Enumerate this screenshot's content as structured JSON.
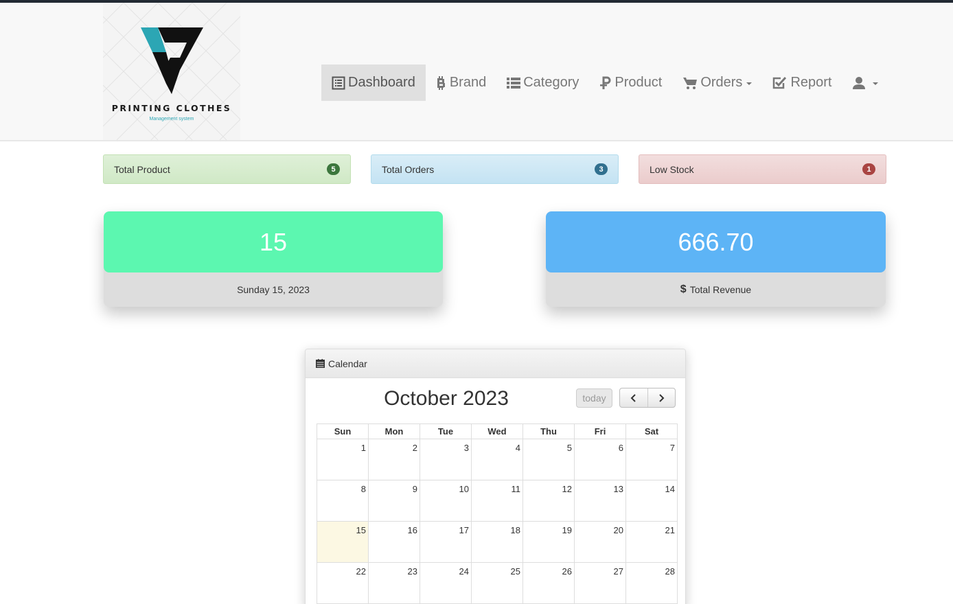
{
  "logo": {
    "title": "PRINTING CLOTHES",
    "subtitle": "Management system"
  },
  "nav": {
    "items": [
      {
        "label": "Dashboard",
        "icon": "list-alt-icon",
        "active": true
      },
      {
        "label": "Brand",
        "icon": "bitcoin-icon"
      },
      {
        "label": "Category",
        "icon": "list-icon"
      },
      {
        "label": "Product",
        "icon": "ruble-icon"
      },
      {
        "label": "Orders",
        "icon": "shopping-cart-icon",
        "dropdown": true
      },
      {
        "label": "Report",
        "icon": "check-icon"
      }
    ],
    "user_icon": "user-icon"
  },
  "stats": [
    {
      "label": "Total Product",
      "count": "5",
      "color": "#3c763d"
    },
    {
      "label": "Total Orders",
      "count": "3",
      "color": "#31708f"
    },
    {
      "label": "Low Stock",
      "count": "1",
      "color": "#a94442"
    }
  ],
  "cards": {
    "date": {
      "value": "15",
      "caption": "Sunday 15, 2023",
      "color": "#5cf7b0"
    },
    "revenue": {
      "value": "666.70",
      "currency": "$",
      "caption": "Total Revenue",
      "color": "#5db4f6"
    }
  },
  "calendar": {
    "panel_title": "Calendar",
    "month_title": "October 2023",
    "today_label": "today",
    "weekdays": [
      "Sun",
      "Mon",
      "Tue",
      "Wed",
      "Thu",
      "Fri",
      "Sat"
    ],
    "weeks": [
      [
        "1",
        "2",
        "3",
        "4",
        "5",
        "6",
        "7"
      ],
      [
        "8",
        "9",
        "10",
        "11",
        "12",
        "13",
        "14"
      ],
      [
        "15",
        "16",
        "17",
        "18",
        "19",
        "20",
        "21"
      ],
      [
        "22",
        "23",
        "24",
        "25",
        "26",
        "27",
        "28"
      ]
    ],
    "today": "15"
  }
}
